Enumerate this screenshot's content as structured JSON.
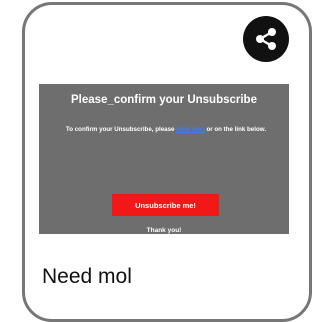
{
  "share": {
    "icon": "share-icon"
  },
  "email": {
    "title": "Please_confirm your Unsubscribe",
    "body_before": "To confirm your Unsubscribe, please ",
    "link_text": "click here",
    "body_after": " or on the link below.",
    "button_label": "Unsubscribe me!",
    "thanks": "Thank you!"
  },
  "below": {
    "text": "Need mol"
  },
  "colors": {
    "panel_bg": "#6e6e6e",
    "button_bg": "#f21818",
    "link": "#3b7cff",
    "share_bg": "#111111"
  }
}
